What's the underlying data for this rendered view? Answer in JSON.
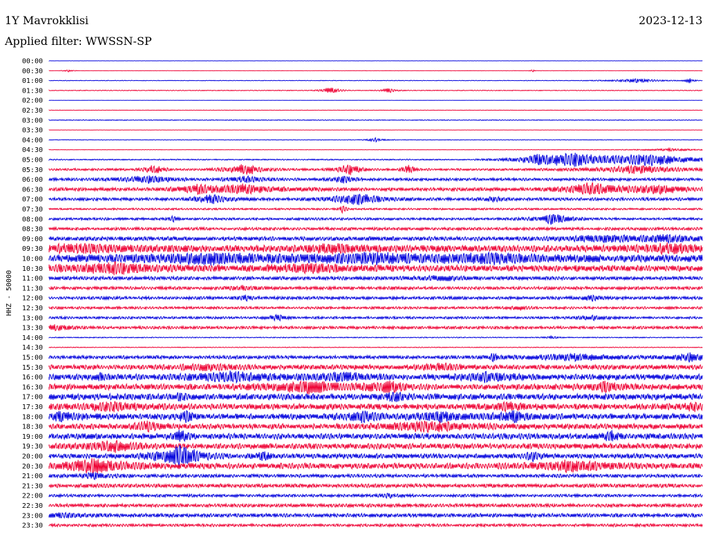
{
  "header": {
    "station": "1Y Mavrokklisi",
    "date": "2023-12-13",
    "filter": "Applied filter: WWSSN-SP"
  },
  "chart_data": {
    "type": "line",
    "title": "1Y Mavrokklisi",
    "subtitle": "Applied filter: WWSSN-SP",
    "ylabel": "HHZ - 50000",
    "series_colors": [
      "#0000dd",
      "#ee0033"
    ],
    "rows": [
      {
        "time": "00:00",
        "amp": 0.1,
        "events": []
      },
      {
        "time": "00:30",
        "amp": 0.15,
        "events": [
          {
            "x": 0.03,
            "a": 2,
            "w": 0.005
          },
          {
            "x": 0.74,
            "a": 2,
            "w": 0.003
          }
        ]
      },
      {
        "time": "01:00",
        "amp": 0.3,
        "events": [
          {
            "x": 0.9,
            "a": 3,
            "w": 0.03
          },
          {
            "x": 0.98,
            "a": 4,
            "w": 0.005
          }
        ]
      },
      {
        "time": "01:30",
        "amp": 0.4,
        "events": [
          {
            "x": 0.43,
            "a": 6,
            "w": 0.01
          },
          {
            "x": 0.52,
            "a": 4,
            "w": 0.008
          }
        ]
      },
      {
        "time": "02:00",
        "amp": 0.1,
        "events": []
      },
      {
        "time": "02:30",
        "amp": 0.2,
        "events": []
      },
      {
        "time": "03:00",
        "amp": 0.4,
        "events": []
      },
      {
        "time": "03:30",
        "amp": 0.1,
        "events": []
      },
      {
        "time": "04:00",
        "amp": 0.3,
        "events": [
          {
            "x": 0.5,
            "a": 3,
            "w": 0.01
          }
        ]
      },
      {
        "time": "04:30",
        "amp": 0.2,
        "events": [
          {
            "x": 0.95,
            "a": 2,
            "w": 0.04
          }
        ]
      },
      {
        "time": "05:00",
        "amp": 0.6,
        "events": [
          {
            "x": 0.8,
            "a": 10,
            "w": 0.05
          },
          {
            "x": 0.92,
            "a": 9,
            "w": 0.06
          },
          {
            "x": 0.75,
            "a": 5,
            "w": 0.02
          }
        ]
      },
      {
        "time": "05:30",
        "amp": 1.2,
        "events": [
          {
            "x": 0.16,
            "a": 8,
            "w": 0.01
          },
          {
            "x": 0.3,
            "a": 9,
            "w": 0.02
          },
          {
            "x": 0.46,
            "a": 8,
            "w": 0.015
          },
          {
            "x": 0.55,
            "a": 9,
            "w": 0.006
          },
          {
            "x": 0.9,
            "a": 6,
            "w": 0.05
          }
        ]
      },
      {
        "time": "06:00",
        "amp": 1.5,
        "events": [
          {
            "x": 0.15,
            "a": 5,
            "w": 0.03
          },
          {
            "x": 0.3,
            "a": 5,
            "w": 0.02
          },
          {
            "x": 0.45,
            "a": 6,
            "w": 0.01
          }
        ]
      },
      {
        "time": "06:30",
        "amp": 1.8,
        "events": [
          {
            "x": 0.23,
            "a": 6,
            "w": 0.02
          },
          {
            "x": 0.3,
            "a": 7,
            "w": 0.04
          },
          {
            "x": 0.83,
            "a": 10,
            "w": 0.03
          },
          {
            "x": 0.93,
            "a": 7,
            "w": 0.03
          }
        ]
      },
      {
        "time": "07:00",
        "amp": 1.6,
        "events": [
          {
            "x": 0.25,
            "a": 7,
            "w": 0.02
          },
          {
            "x": 0.47,
            "a": 9,
            "w": 0.03
          },
          {
            "x": 0.68,
            "a": 4,
            "w": 0.01
          }
        ]
      },
      {
        "time": "07:30",
        "amp": 1.0,
        "events": [
          {
            "x": 0.45,
            "a": 6,
            "w": 0.004
          }
        ]
      },
      {
        "time": "08:00",
        "amp": 1.3,
        "events": [
          {
            "x": 0.19,
            "a": 5,
            "w": 0.005
          },
          {
            "x": 0.77,
            "a": 8,
            "w": 0.02
          }
        ]
      },
      {
        "time": "08:30",
        "amp": 1.5,
        "events": []
      },
      {
        "time": "09:00",
        "amp": 2.2,
        "events": [
          {
            "x": 0.85,
            "a": 4,
            "w": 0.05
          },
          {
            "x": 0.95,
            "a": 4,
            "w": 0.04
          }
        ]
      },
      {
        "time": "09:30",
        "amp": 3.5,
        "events": [
          {
            "x": 0.05,
            "a": 5,
            "w": 0.05
          },
          {
            "x": 0.44,
            "a": 5,
            "w": 0.04
          },
          {
            "x": 0.95,
            "a": 5,
            "w": 0.04
          }
        ]
      },
      {
        "time": "10:00",
        "amp": 3.8,
        "events": [
          {
            "x": 0.25,
            "a": 7,
            "w": 0.08
          },
          {
            "x": 0.5,
            "a": 6,
            "w": 0.06
          },
          {
            "x": 0.68,
            "a": 6,
            "w": 0.06
          }
        ]
      },
      {
        "time": "10:30",
        "amp": 3.2,
        "events": [
          {
            "x": 0.1,
            "a": 6,
            "w": 0.07
          },
          {
            "x": 0.4,
            "a": 5,
            "w": 0.05
          }
        ]
      },
      {
        "time": "11:00",
        "amp": 1.8,
        "events": [
          {
            "x": 0.6,
            "a": 3,
            "w": 0.04
          }
        ]
      },
      {
        "time": "11:30",
        "amp": 1.6,
        "events": [
          {
            "x": 0.3,
            "a": 3,
            "w": 0.02
          }
        ]
      },
      {
        "time": "12:00",
        "amp": 1.6,
        "events": [
          {
            "x": 0.3,
            "a": 4,
            "w": 0.01
          },
          {
            "x": 0.83,
            "a": 4,
            "w": 0.01
          }
        ]
      },
      {
        "time": "12:30",
        "amp": 1.3,
        "events": [
          {
            "x": 0.72,
            "a": 3,
            "w": 0.01
          }
        ]
      },
      {
        "time": "13:00",
        "amp": 1.3,
        "events": [
          {
            "x": 0.35,
            "a": 4,
            "w": 0.01
          },
          {
            "x": 0.83,
            "a": 3,
            "w": 0.02
          }
        ]
      },
      {
        "time": "13:30",
        "amp": 1.5,
        "events": [
          {
            "x": 0.01,
            "a": 4,
            "w": 0.02
          }
        ]
      },
      {
        "time": "14:00",
        "amp": 0.5,
        "events": [
          {
            "x": 0.77,
            "a": 2,
            "w": 0.01
          }
        ]
      },
      {
        "time": "14:30",
        "amp": 0.4,
        "events": []
      },
      {
        "time": "15:00",
        "amp": 1.8,
        "events": [
          {
            "x": 0.68,
            "a": 6,
            "w": 0.005
          },
          {
            "x": 0.8,
            "a": 5,
            "w": 0.05
          },
          {
            "x": 0.98,
            "a": 6,
            "w": 0.02
          }
        ]
      },
      {
        "time": "15:30",
        "amp": 2.5,
        "events": [
          {
            "x": 0.24,
            "a": 4,
            "w": 0.03
          },
          {
            "x": 0.6,
            "a": 4,
            "w": 0.03
          }
        ]
      },
      {
        "time": "16:00",
        "amp": 3.0,
        "events": [
          {
            "x": 0.08,
            "a": 6,
            "w": 0.005
          },
          {
            "x": 0.28,
            "a": 6,
            "w": 0.05
          },
          {
            "x": 0.45,
            "a": 6,
            "w": 0.03
          },
          {
            "x": 0.67,
            "a": 6,
            "w": 0.03
          }
        ]
      },
      {
        "time": "16:30",
        "amp": 3.0,
        "events": [
          {
            "x": 0.4,
            "a": 8,
            "w": 0.05
          },
          {
            "x": 0.52,
            "a": 8,
            "w": 0.02
          },
          {
            "x": 0.85,
            "a": 6,
            "w": 0.02
          }
        ]
      },
      {
        "time": "17:00",
        "amp": 3.2,
        "events": [
          {
            "x": 0.2,
            "a": 6,
            "w": 0.005
          },
          {
            "x": 0.53,
            "a": 7,
            "w": 0.01
          }
        ]
      },
      {
        "time": "17:30",
        "amp": 3.0,
        "events": [
          {
            "x": 0.1,
            "a": 5,
            "w": 0.04
          },
          {
            "x": 0.7,
            "a": 5,
            "w": 0.02
          },
          {
            "x": 0.99,
            "a": 4,
            "w": 0.03
          }
        ]
      },
      {
        "time": "18:00",
        "amp": 3.0,
        "events": [
          {
            "x": 0.02,
            "a": 6,
            "w": 0.02
          },
          {
            "x": 0.21,
            "a": 8,
            "w": 0.01
          },
          {
            "x": 0.48,
            "a": 8,
            "w": 0.02
          },
          {
            "x": 0.6,
            "a": 6,
            "w": 0.03
          },
          {
            "x": 0.71,
            "a": 7,
            "w": 0.02
          }
        ]
      },
      {
        "time": "18:30",
        "amp": 2.8,
        "events": [
          {
            "x": 0.15,
            "a": 6,
            "w": 0.02
          },
          {
            "x": 0.58,
            "a": 7,
            "w": 0.05
          }
        ]
      },
      {
        "time": "19:00",
        "amp": 3.0,
        "events": [
          {
            "x": 0.2,
            "a": 8,
            "w": 0.01
          },
          {
            "x": 0.86,
            "a": 6,
            "w": 0.01
          }
        ]
      },
      {
        "time": "19:30",
        "amp": 2.8,
        "events": [
          {
            "x": 0.1,
            "a": 7,
            "w": 0.03
          }
        ]
      },
      {
        "time": "20:00",
        "amp": 2.5,
        "events": [
          {
            "x": 0.2,
            "a": 18,
            "w": 0.025
          },
          {
            "x": 0.33,
            "a": 6,
            "w": 0.01
          },
          {
            "x": 0.74,
            "a": 6,
            "w": 0.01
          }
        ]
      },
      {
        "time": "20:30",
        "amp": 3.0,
        "events": [
          {
            "x": 0.07,
            "a": 10,
            "w": 0.04
          },
          {
            "x": 0.8,
            "a": 8,
            "w": 0.04
          }
        ]
      },
      {
        "time": "21:00",
        "amp": 1.8,
        "events": [
          {
            "x": 0.07,
            "a": 4,
            "w": 0.02
          }
        ]
      },
      {
        "time": "21:30",
        "amp": 2.0,
        "events": []
      },
      {
        "time": "22:00",
        "amp": 1.5,
        "events": [
          {
            "x": 0.52,
            "a": 3,
            "w": 0.01
          }
        ]
      },
      {
        "time": "22:30",
        "amp": 1.8,
        "events": []
      },
      {
        "time": "23:00",
        "amp": 2.0,
        "events": [
          {
            "x": 0.02,
            "a": 3,
            "w": 0.02
          }
        ]
      },
      {
        "time": "23:30",
        "amp": 1.5,
        "events": []
      }
    ]
  }
}
